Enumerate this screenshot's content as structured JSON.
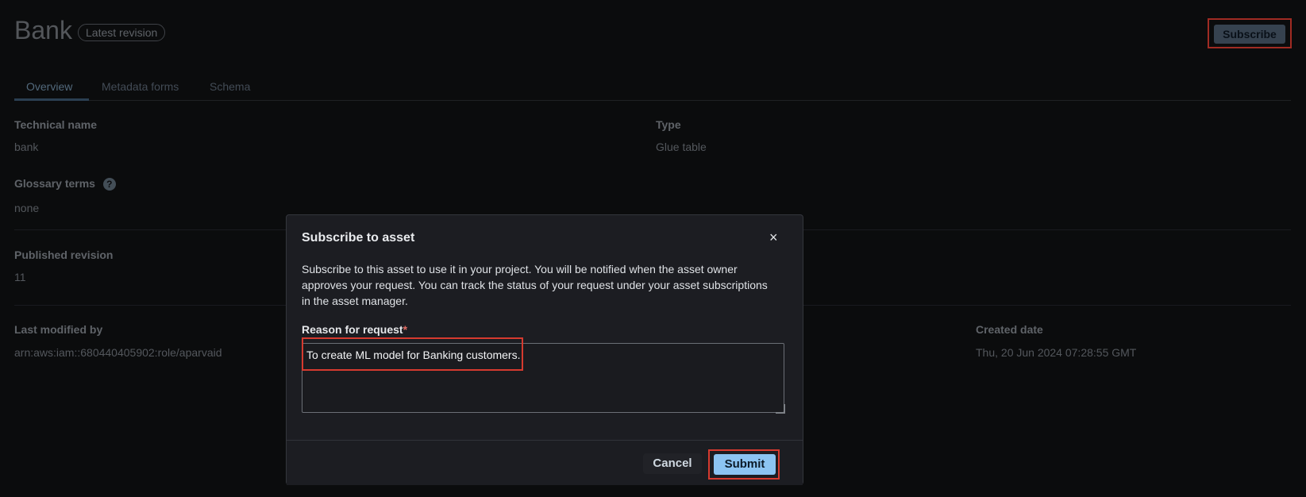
{
  "header": {
    "title": "Bank",
    "badge": "Latest revision",
    "subscribe_label": "Subscribe"
  },
  "tabs": [
    {
      "label": "Overview"
    },
    {
      "label": "Metadata forms"
    },
    {
      "label": "Schema"
    }
  ],
  "details": {
    "technical_name_label": "Technical name",
    "technical_name_value": "bank",
    "type_label": "Type",
    "type_value": "Glue table",
    "glossary_label": "Glossary terms",
    "glossary_help": "?",
    "glossary_value": "none",
    "published_label": "Published revision",
    "published_value": "11",
    "last_modified_label": "Last modified by",
    "last_modified_value": "arn:aws:iam::680440405902:role/aparvaid",
    "created_label": "Created date",
    "created_value": "Thu, 20 Jun 2024 07:28:55 GMT"
  },
  "modal": {
    "title": "Subscribe to asset",
    "close_glyph": "×",
    "description": "Subscribe to this asset to use it in your project. You will be notified when the asset owner approves your request. You can track the status of your request under your asset subscriptions in the asset manager.",
    "reason_label": "Reason for request",
    "required_mark": "*",
    "reason_value": "To create ML model for Banking customers.",
    "cancel_label": "Cancel",
    "submit_label": "Submit"
  },
  "colors": {
    "accent": "#8cc4f2",
    "highlight": "#d63a2f",
    "required": "#e06b63"
  }
}
